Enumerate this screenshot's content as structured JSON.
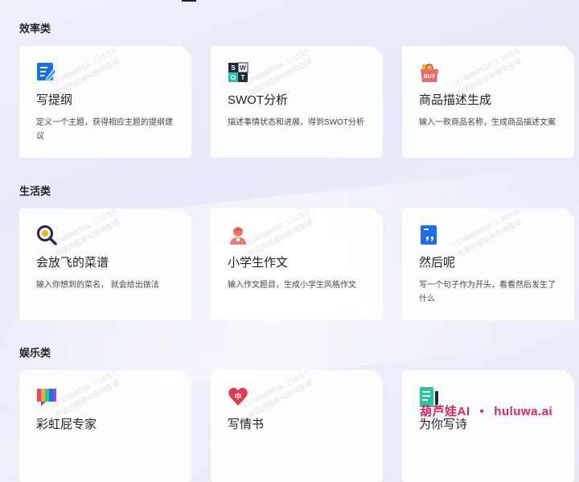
{
  "sections": [
    {
      "title": "效率类",
      "cards": [
        {
          "title": "写提纲",
          "desc": "定义一个主题，获得相应主题的提纲建议",
          "icon": "outline-icon"
        },
        {
          "title": "SWOT分析",
          "desc": "描述事情状态和进展，得到SWOT分析",
          "icon": "swot-icon"
        },
        {
          "title": "商品描述生成",
          "desc": "输入一款商品名称，生成商品描述文案",
          "icon": "shopping-bag-icon"
        }
      ]
    },
    {
      "title": "生活类",
      "cards": [
        {
          "title": "会放飞的菜谱",
          "desc": "输入你想到的菜名， 就会给出做法",
          "icon": "magnifier-icon"
        },
        {
          "title": "小学生作文",
          "desc": "输入作文题目，生成小学生风格作文",
          "icon": "student-icon"
        },
        {
          "title": "然后呢",
          "desc": "写一个句子作为开头，看看然后发生了什么",
          "icon": "quote-doc-icon"
        }
      ]
    },
    {
      "title": "娱乐类",
      "cards": [
        {
          "title": "彩虹屁专家",
          "desc": "",
          "icon": "rainbow-chat-icon"
        },
        {
          "title": "写情书",
          "desc": "",
          "icon": "heart-icon"
        },
        {
          "title": "为你写诗",
          "desc": "",
          "icon": "poem-doc-icon"
        }
      ]
    }
  ],
  "icon_text": {
    "swot": [
      "S",
      "W",
      "O",
      "T"
    ],
    "buy": "BUY",
    "heart": "中"
  },
  "watermark": {
    "line1": "13748868518,  1:10:5:5",
    "line2": "对话内容由AI自动生成"
  },
  "brand": {
    "name": "葫芦娃AI",
    "dot": "•",
    "domain": "huluwa.ai"
  },
  "colors": {
    "accent_blue": "#1a6ef5",
    "brand_pink": "#e0245e",
    "heart_red": "#e8374a",
    "swot_dark": "#1d2b3a",
    "swot_green": "#2bc4a0"
  }
}
